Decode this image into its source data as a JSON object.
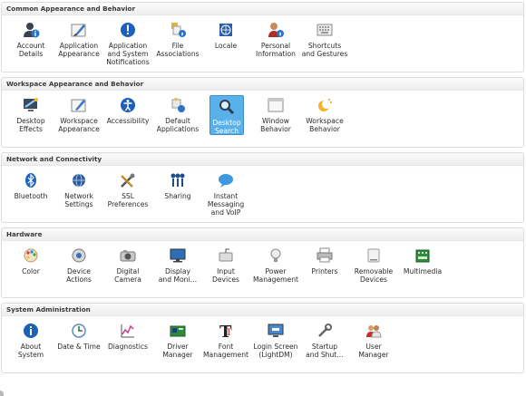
{
  "sections": [
    {
      "title": "Common Appearance and Behavior",
      "items": [
        {
          "label": "Account\nDetails",
          "icon": "account-user-icon"
        },
        {
          "label": "Application\nAppearance",
          "icon": "paint-brush-icon"
        },
        {
          "label": "Application\nand System\nNotifications",
          "icon": "notification-exclamation-icon"
        },
        {
          "label": "File\nAssociations",
          "icon": "file-associations-icon"
        },
        {
          "label": "Locale",
          "icon": "globe-flag-icon"
        },
        {
          "label": "Personal\nInformation",
          "icon": "personal-info-icon"
        },
        {
          "label": "Shortcuts\nand Gestures",
          "icon": "keyboard-icon"
        }
      ]
    },
    {
      "title": "Workspace Appearance and Behavior",
      "items": [
        {
          "label": "Desktop\nEffects",
          "icon": "desktop-effects-icon"
        },
        {
          "label": "Workspace\nAppearance",
          "icon": "workspace-appearance-icon"
        },
        {
          "label": "Accessibility",
          "icon": "accessibility-icon"
        },
        {
          "label": "Default\nApplications",
          "icon": "default-apps-icon"
        },
        {
          "label": "Desktop\nSearch",
          "icon": "magnifier-search-icon",
          "selected": true
        },
        {
          "label": "Window\nBehavior",
          "icon": "window-icon"
        },
        {
          "label": "Workspace\nBehavior",
          "icon": "workspace-behavior-icon"
        }
      ]
    },
    {
      "title": "Network and Connectivity",
      "items": [
        {
          "label": "Bluetooth",
          "icon": "bluetooth-icon"
        },
        {
          "label": "Network\nSettings",
          "icon": "network-globe-icon"
        },
        {
          "label": "SSL\nPreferences",
          "icon": "tools-icon"
        },
        {
          "label": "Sharing",
          "icon": "sharing-icon"
        },
        {
          "label": "Instant\nMessaging\nand VoIP",
          "icon": "chat-bubble-icon"
        }
      ]
    },
    {
      "title": "Hardware",
      "items": [
        {
          "label": "Color",
          "icon": "color-palette-icon"
        },
        {
          "label": "Device\nActions",
          "icon": "device-actions-icon"
        },
        {
          "label": "Digital\nCamera",
          "icon": "camera-icon"
        },
        {
          "label": "Display\nand Moni…",
          "icon": "monitor-icon"
        },
        {
          "label": "Input\nDevices",
          "icon": "input-devices-icon"
        },
        {
          "label": "Power\nManagement",
          "icon": "lightbulb-icon"
        },
        {
          "label": "Printers",
          "icon": "printer-icon"
        },
        {
          "label": "Removable\nDevices",
          "icon": "removable-drive-icon"
        },
        {
          "label": "Multimedia",
          "icon": "multimedia-board-icon"
        }
      ]
    },
    {
      "title": "System Administration",
      "items": [
        {
          "label": "About\nSystem",
          "icon": "info-icon"
        },
        {
          "label": "Date & Time",
          "icon": "clock-icon"
        },
        {
          "label": "Diagnostics",
          "icon": "diagnostics-chart-icon"
        },
        {
          "label": "Driver\nManager",
          "icon": "driver-card-icon"
        },
        {
          "label": "Font\nManagement",
          "icon": "font-icon"
        },
        {
          "label": "Login Screen\n(LightDM)",
          "icon": "login-screen-icon"
        },
        {
          "label": "Startup\nand Shut…",
          "icon": "wrench-icon"
        },
        {
          "label": "User\nManager",
          "icon": "users-icon"
        }
      ]
    }
  ]
}
